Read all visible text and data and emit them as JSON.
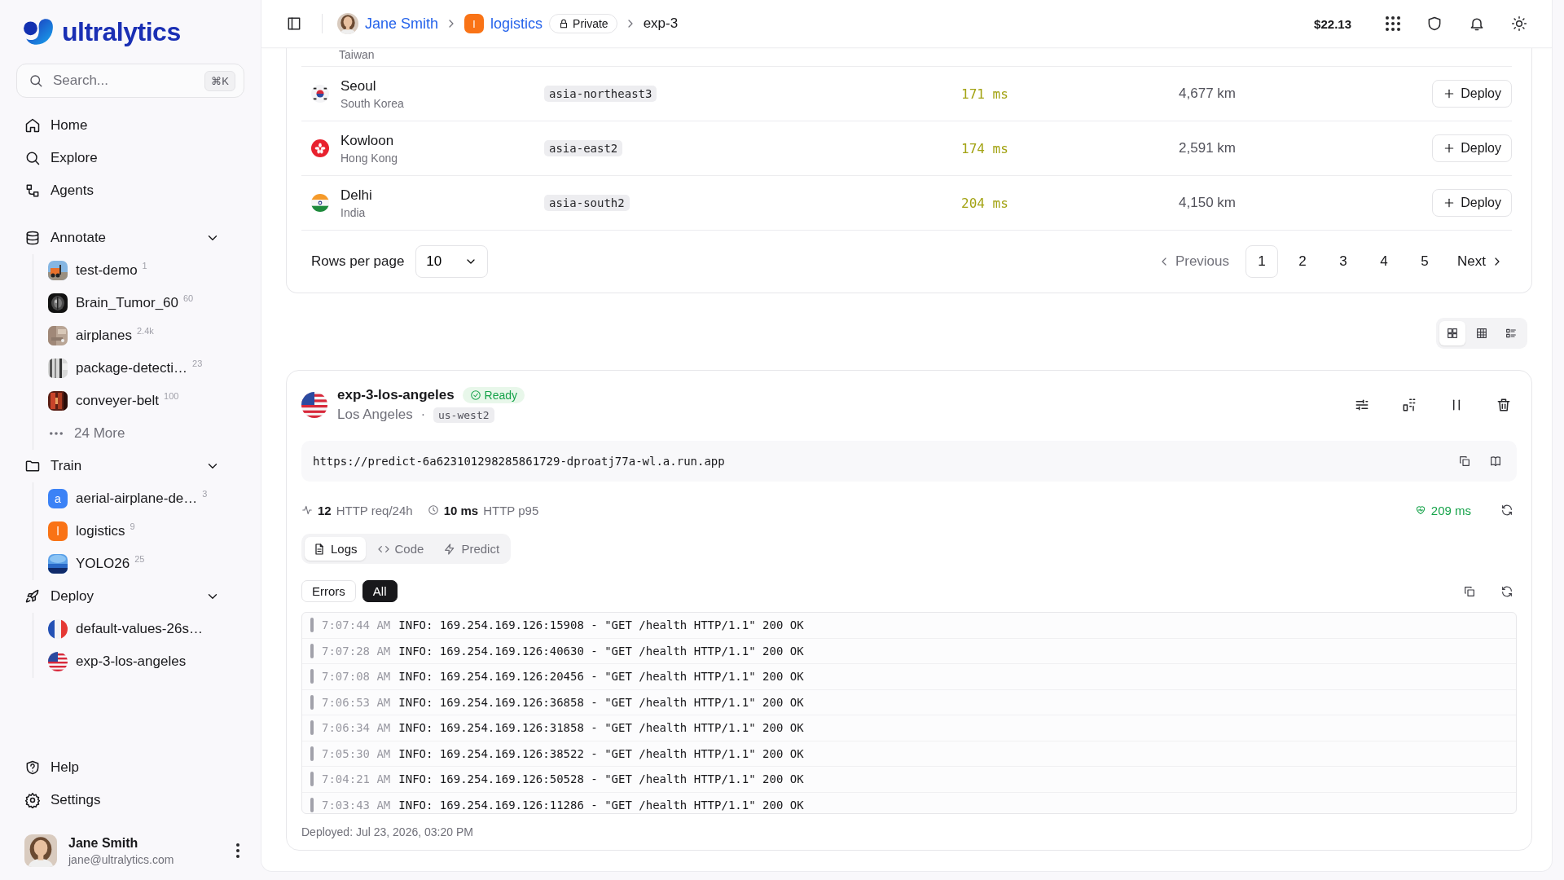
{
  "sidebar": {
    "logo": "ultralytics",
    "search": {
      "placeholder": "Search...",
      "shortcut": "⌘K"
    },
    "nav": [
      {
        "label": "Home"
      },
      {
        "label": "Explore"
      },
      {
        "label": "Agents"
      }
    ],
    "sections": [
      {
        "label": "Annotate",
        "expanded": true,
        "more": "24 More",
        "items": [
          {
            "label": "test-demo",
            "count": "1",
            "kind": "picture"
          },
          {
            "label": "Brain_Tumor_60",
            "count": "60",
            "kind": "picture"
          },
          {
            "label": "airplanes",
            "count": "2.4k",
            "kind": "picture"
          },
          {
            "label": "package-detecti…",
            "count": "23",
            "kind": "picture"
          },
          {
            "label": "conveyer-belt",
            "count": "100",
            "kind": "picture"
          }
        ]
      },
      {
        "label": "Train",
        "expanded": true,
        "items": [
          {
            "label": "aerial-airplane-de…",
            "count": "3",
            "kind": "letter",
            "letter": "a",
            "color": "#3b82f6"
          },
          {
            "label": "logistics",
            "count": "9",
            "kind": "letter",
            "letter": "l",
            "color": "#f97316"
          },
          {
            "label": "YOLO26",
            "count": "25",
            "kind": "picture"
          }
        ]
      },
      {
        "label": "Deploy",
        "expanded": true,
        "items": [
          {
            "label": "default-values-26s…",
            "kind": "flag"
          },
          {
            "label": "exp-3-los-angeles",
            "kind": "flag"
          }
        ]
      }
    ],
    "bottom_nav": [
      {
        "label": "Help"
      },
      {
        "label": "Settings"
      }
    ],
    "user": {
      "name": "Jane Smith",
      "email": "jane@ultralytics.com"
    }
  },
  "header": {
    "breadcrumb": {
      "user": "Jane Smith",
      "project_letter": "l",
      "project": "logistics",
      "visibility": "Private",
      "page": "exp-3"
    },
    "balance": "$22.13"
  },
  "regions_table": {
    "partial_row": {
      "country": "Taiwan"
    },
    "rows": [
      {
        "city": "Seoul",
        "country": "South Korea",
        "region": "asia-northeast3",
        "latency": "171 ms",
        "distance": "4,677 km",
        "action": "Deploy"
      },
      {
        "city": "Kowloon",
        "country": "Hong Kong",
        "region": "asia-east2",
        "latency": "174 ms",
        "distance": "2,591 km",
        "action": "Deploy"
      },
      {
        "city": "Delhi",
        "country": "India",
        "region": "asia-south2",
        "latency": "204 ms",
        "distance": "4,150 km",
        "action": "Deploy"
      }
    ],
    "pagination": {
      "rows_per_page_label": "Rows per page",
      "rows_per_page": "10",
      "previous": "Previous",
      "next": "Next",
      "pages": [
        {
          "label": "1",
          "selected": true
        },
        {
          "label": "2",
          "selected": false
        },
        {
          "label": "3",
          "selected": false
        },
        {
          "label": "4",
          "selected": false
        },
        {
          "label": "5",
          "selected": false
        }
      ]
    }
  },
  "view_options": [
    {
      "selected": true
    },
    {
      "selected": false
    },
    {
      "selected": false
    }
  ],
  "deployment": {
    "name": "exp-3-los-angeles",
    "status": "Ready",
    "city": "Los Angeles",
    "separator": "·",
    "region": "us-west2",
    "url": "https://predict-6a623101298285861729-dproatj77a-wl.a.run.app",
    "stats": [
      {
        "value": "12",
        "label": "HTTP req/24h"
      },
      {
        "value": "10 ms",
        "label": "HTTP p95"
      }
    ],
    "health": "209 ms",
    "tabs": [
      {
        "label": "Logs",
        "selected": true
      },
      {
        "label": "Code",
        "selected": false
      },
      {
        "label": "Predict",
        "selected": false
      }
    ],
    "filters": [
      {
        "label": "Errors",
        "selected": false
      },
      {
        "label": "All",
        "selected": true
      }
    ],
    "logs": [
      {
        "time": "7:07:44 AM",
        "message": "INFO: 169.254.169.126:15908 - \"GET /health HTTP/1.1\" 200 OK"
      },
      {
        "time": "7:07:28 AM",
        "message": "INFO: 169.254.169.126:40630 - \"GET /health HTTP/1.1\" 200 OK"
      },
      {
        "time": "7:07:08 AM",
        "message": "INFO: 169.254.169.126:20456 - \"GET /health HTTP/1.1\" 200 OK"
      },
      {
        "time": "7:06:53 AM",
        "message": "INFO: 169.254.169.126:36858 - \"GET /health HTTP/1.1\" 200 OK"
      },
      {
        "time": "7:06:34 AM",
        "message": "INFO: 169.254.169.126:31858 - \"GET /health HTTP/1.1\" 200 OK"
      },
      {
        "time": "7:05:30 AM",
        "message": "INFO: 169.254.169.126:38522 - \"GET /health HTTP/1.1\" 200 OK"
      },
      {
        "time": "7:04:21 AM",
        "message": "INFO: 169.254.169.126:50528 - \"GET /health HTTP/1.1\" 200 OK"
      },
      {
        "time": "7:03:43 AM",
        "message": "INFO: 169.254.169.126:11286 - \"GET /health HTTP/1.1\" 200 OK"
      }
    ],
    "deployed": "Deployed: Jul 23, 2026, 03:20 PM"
  }
}
